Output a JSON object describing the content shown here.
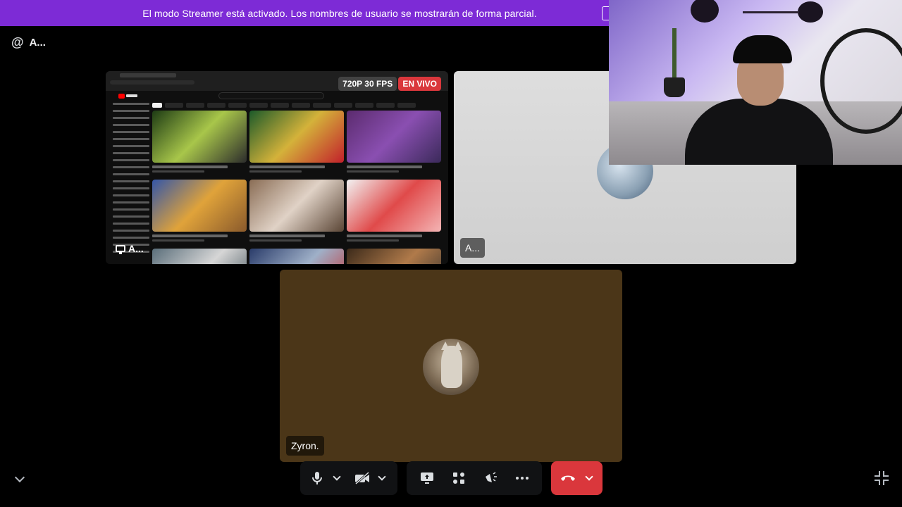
{
  "banner": {
    "text": "El modo Streamer está activado. Los nombres de usuario se mostrarán de forma parcial."
  },
  "channel": {
    "icon": "at-icon",
    "name": "A..."
  },
  "stream": {
    "quality_badge": "720P 30 FPS",
    "live_badge": "EN VIVO",
    "streamer_label": "A..."
  },
  "participants": [
    {
      "name": "A...",
      "tile_color": "#d8d8d8"
    },
    {
      "name": "Zyron.",
      "tile_color": "#4b3618"
    }
  ],
  "controls": {
    "buttons": [
      {
        "name": "microphone",
        "icon": "microphone-icon"
      },
      {
        "name": "camera",
        "icon": "camera-off-icon"
      },
      {
        "name": "share-screen",
        "icon": "screen-share-icon"
      },
      {
        "name": "activities",
        "icon": "activities-icon"
      },
      {
        "name": "soundboard",
        "icon": "soundboard-icon"
      },
      {
        "name": "more",
        "icon": "more-icon"
      },
      {
        "name": "leave-call",
        "icon": "hang-up-icon"
      }
    ]
  },
  "colors": {
    "banner": "#7d2bd6",
    "leave": "#da373c",
    "live": "#da373c",
    "controls_bg": "#111214"
  }
}
